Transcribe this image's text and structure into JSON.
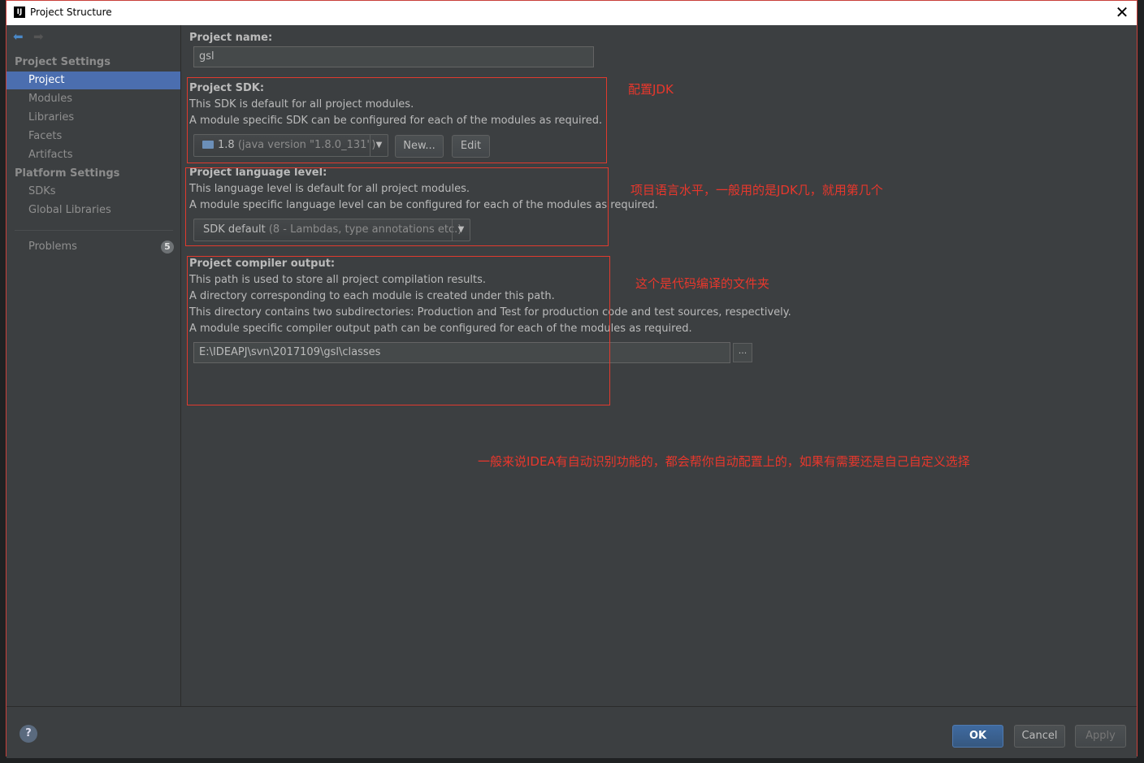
{
  "window": {
    "title": "Project Structure",
    "close_glyph": "✕",
    "app_icon": "IJ"
  },
  "sidebar": {
    "back_icon": "arrow-left-icon",
    "forward_icon": "arrow-right-icon",
    "project_settings_header": "Project Settings",
    "project_settings_items": [
      "Project",
      "Modules",
      "Libraries",
      "Facets",
      "Artifacts"
    ],
    "platform_settings_header": "Platform Settings",
    "platform_settings_items": [
      "SDKs",
      "Global Libraries"
    ],
    "problems": {
      "label": "Problems",
      "count": "5"
    },
    "selected": "Project"
  },
  "project_name": {
    "label": "Project name:",
    "value": "gsl"
  },
  "sdk": {
    "label": "Project SDK:",
    "desc1": "This SDK is default for all project modules.",
    "desc2": "A module specific SDK can be configured for each of the modules as required.",
    "selected_version": "1.8",
    "selected_detail": "(java version \"1.8.0_131\")",
    "new_button": "New...",
    "edit_button": "Edit"
  },
  "language_level": {
    "label": "Project language level:",
    "desc1": "This language level is default for all project modules.",
    "desc2": "A module specific language level can be configured for each of the modules as required.",
    "selected_main": "SDK default",
    "selected_detail": "(8 - Lambdas, type annotations etc.)"
  },
  "compiler_output": {
    "label": "Project compiler output:",
    "desc1": "This path is used to store all project compilation results.",
    "desc2": "A directory corresponding to each module is created under this path.",
    "desc3": "This directory contains two subdirectories: Production and Test for production code and test sources, respectively.",
    "desc4": "A module specific compiler output path can be configured for each of the modules as required.",
    "path": "E:\\IDEAPJ\\svn\\2017109\\gsl\\classes",
    "browse": "..."
  },
  "annotations": {
    "sdk": "配置JDK",
    "language": "项目语言水平，一般用的是JDK几，就用第几个",
    "output": "这个是代码编译的文件夹",
    "general": "一般来说IDEA有自动识别功能的，都会帮你自动配置上的，如果有需要还是自己自定义选择"
  },
  "footer": {
    "help": "?",
    "ok": "OK",
    "cancel": "Cancel",
    "apply": "Apply"
  },
  "colors": {
    "background": "#3c3f41",
    "selection": "#4b6eaf",
    "annotation": "#e8372c"
  }
}
